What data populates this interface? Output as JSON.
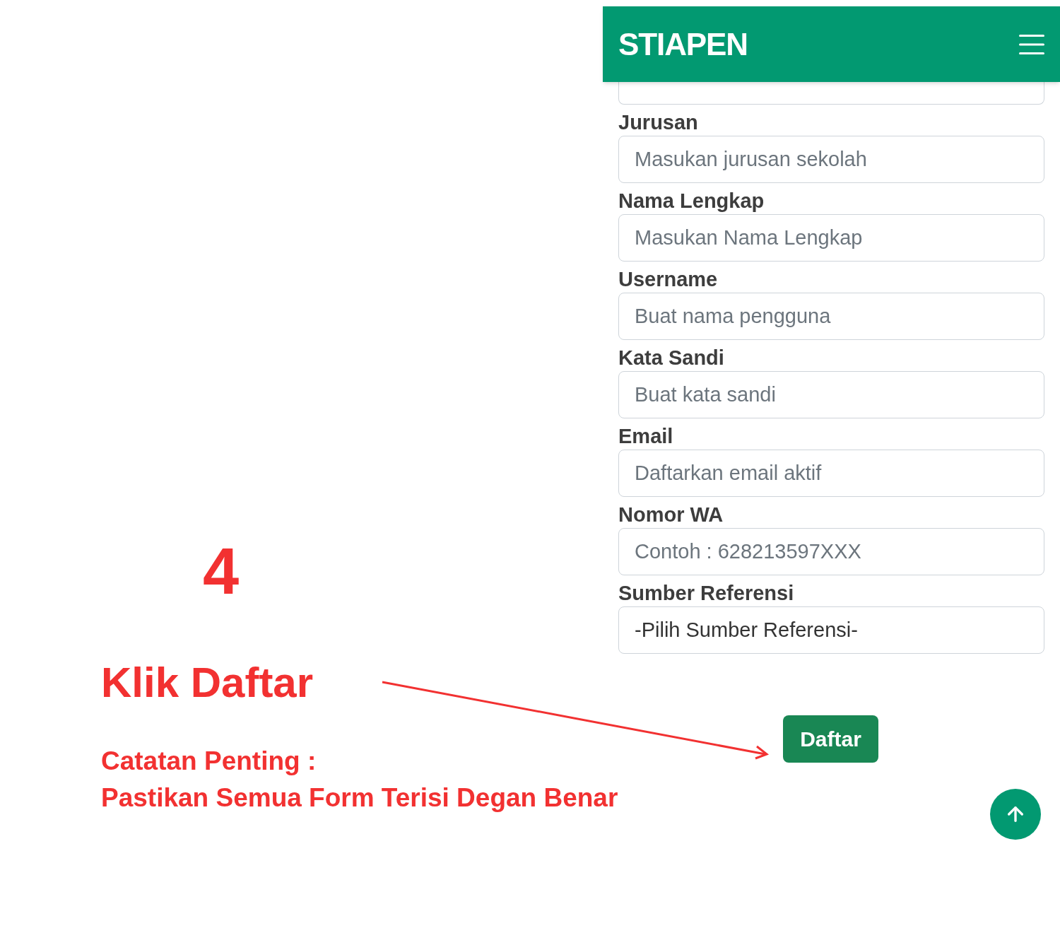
{
  "annotation": {
    "step": "4",
    "title": "Klik Daftar",
    "note_lines": [
      "Catatan Penting :",
      "Pastikan Semua Form Terisi Degan Benar"
    ]
  },
  "header": {
    "brand": "STIAPEN"
  },
  "form": {
    "fields": [
      {
        "kind": "input",
        "label": "Jurusan",
        "placeholder": "Masukan jurusan sekolah"
      },
      {
        "kind": "input",
        "label": "Nama Lengkap",
        "placeholder": "Masukan Nama Lengkap"
      },
      {
        "kind": "input",
        "label": "Username",
        "placeholder": "Buat nama pengguna"
      },
      {
        "kind": "input",
        "label": "Kata Sandi",
        "placeholder": "Buat kata sandi"
      },
      {
        "kind": "input",
        "label": "Email",
        "placeholder": "Daftarkan email aktif"
      },
      {
        "kind": "input",
        "label": "Nomor WA",
        "placeholder": "Contoh : 628213597XXX"
      },
      {
        "kind": "select",
        "label": "Sumber Referensi",
        "value": "-Pilih Sumber Referensi-"
      }
    ],
    "submit": "Daftar"
  }
}
